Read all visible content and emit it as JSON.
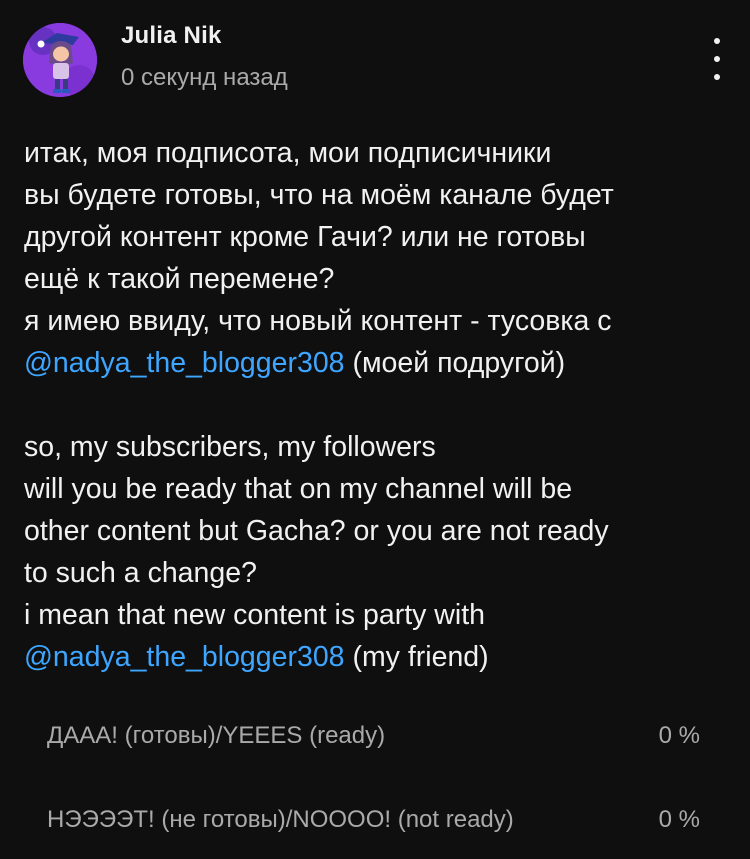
{
  "post": {
    "author": "Julia Nik",
    "timestamp": "0 секунд назад",
    "menu_icon": "more-vert-icon",
    "text_ru": {
      "line1": "итак, моя подписота, мои подписичники",
      "line2": "вы будете готовы, что на моём канале будет",
      "line3": "другой контент кроме Гачи? или не готовы",
      "line4": "ещё к такой перемене?",
      "line5": "я имею ввиду, что новый контент - тусовка с",
      "mention": "@nadya_the_blogger308",
      "after_mention": " (моей подругой)"
    },
    "text_en": {
      "line1": "so, my subscribers, my followers",
      "line2": "will you be ready that on my channel will be",
      "line3": "other content but Gacha? or you are not ready",
      "line4": "to such a change?",
      "line5": "i mean that new content is party with",
      "mention": "@nadya_the_blogger308",
      "after_mention": " (my friend)"
    },
    "mention_color": "#3ea6ff"
  },
  "poll": {
    "options": [
      {
        "label": "ДААА! (готовы)/YEEES (ready)",
        "percent": "0 %"
      },
      {
        "label": "НЭЭЭЭТ! (не готовы)/NOOOO! (not ready)",
        "percent": "0 %"
      }
    ]
  }
}
